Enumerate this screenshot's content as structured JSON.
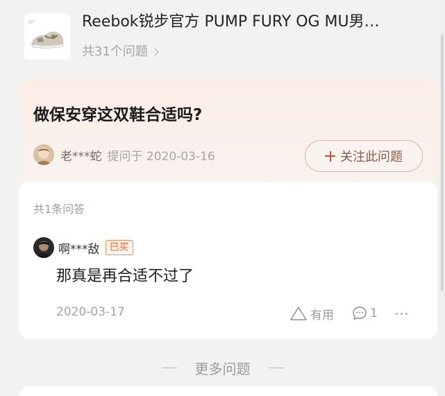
{
  "product": {
    "title": "Reebok锐步官方 PUMP FURY OG MU男…",
    "question_count": "共31个问题",
    "image_icon": "sneaker-thumbnail"
  },
  "question": {
    "title": "做保安穿这双鞋合适吗?",
    "asker_name": "老***蛇",
    "asked_at": "提问于 2020-03-16",
    "follow_label": "关注此问题"
  },
  "answers": {
    "count_label": "共1条问答",
    "items": [
      {
        "user": "啊***敌",
        "badge": "已买",
        "text": "那真是再合适不过了",
        "date": "2020-03-17",
        "useful_label": "有用",
        "comment_count": "1"
      }
    ]
  },
  "footer": {
    "more_label": "更多问题"
  },
  "colors": {
    "accent": "#e8632b",
    "follow_border": "#e1b8a6",
    "page_bg": "#f2f2f2",
    "question_card_bg": "#fbeee6"
  }
}
